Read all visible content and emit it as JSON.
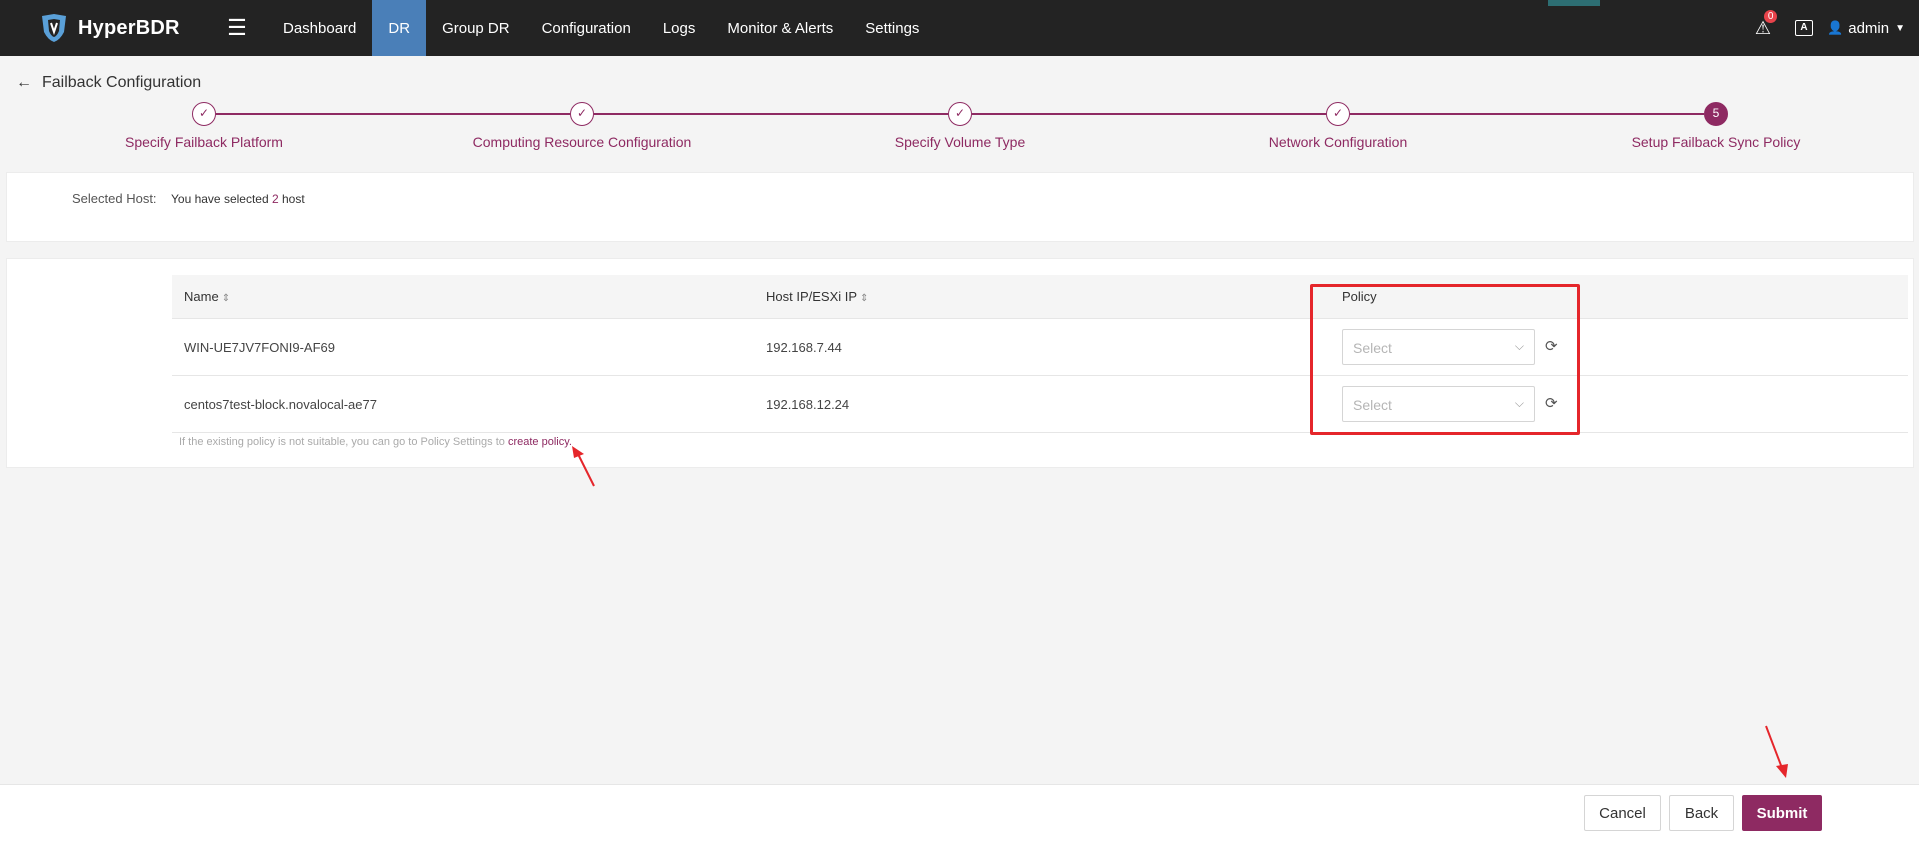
{
  "app": {
    "name": "HyperBDR"
  },
  "nav": {
    "items": [
      {
        "label": "Dashboard",
        "active": false
      },
      {
        "label": "DR",
        "active": true
      },
      {
        "label": "Group DR",
        "active": false
      },
      {
        "label": "Configuration",
        "active": false
      },
      {
        "label": "Logs",
        "active": false
      },
      {
        "label": "Monitor & Alerts",
        "active": false
      },
      {
        "label": "Settings",
        "active": false
      }
    ]
  },
  "header": {
    "alert_count": "0",
    "lang_icon": "A",
    "user": "admin"
  },
  "page": {
    "title": "Failback Configuration"
  },
  "stepper": {
    "steps": [
      {
        "label": "Specify Failback Platform",
        "status": "done"
      },
      {
        "label": "Computing Resource Configuration",
        "status": "done"
      },
      {
        "label": "Specify Volume Type",
        "status": "done"
      },
      {
        "label": "Network Configuration",
        "status": "done"
      },
      {
        "label": "Setup Failback Sync Policy",
        "status": "current",
        "number": "5"
      }
    ]
  },
  "selected_host": {
    "label": "Selected Host:",
    "prefix": "You have selected ",
    "count": "2",
    "suffix": " host"
  },
  "table": {
    "columns": {
      "name": "Name",
      "ip": "Host IP/ESXi IP",
      "policy": "Policy"
    },
    "rows": [
      {
        "name": "WIN-UE7JV7FONI9-AF69",
        "ip": "192.168.7.44",
        "policy_placeholder": "Select"
      },
      {
        "name": "centos7test-block.novalocal-ae77",
        "ip": "192.168.12.24",
        "policy_placeholder": "Select"
      }
    ],
    "hint_text": "If the existing policy is not suitable, you can go to Policy Settings to ",
    "hint_link": "create policy."
  },
  "footer": {
    "cancel_label": "Cancel",
    "back_label": "Back",
    "submit_label": "Submit"
  },
  "colors": {
    "accent": "#8e2a62",
    "nav_active": "#4a7fb8",
    "annotation": "#e5262b"
  }
}
